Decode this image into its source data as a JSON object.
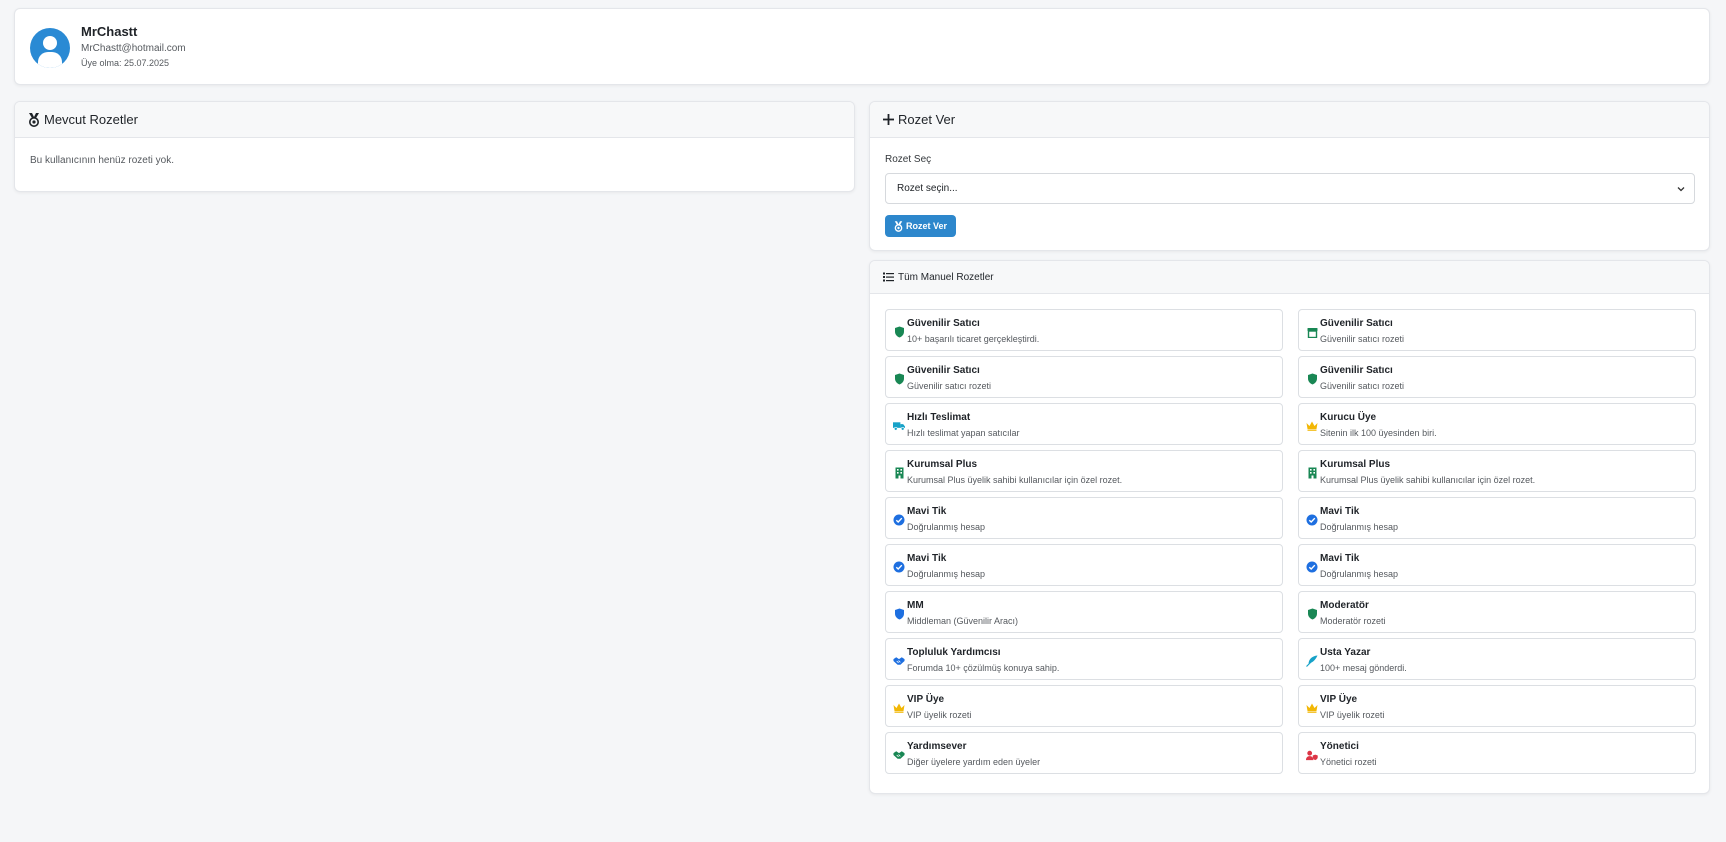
{
  "profile": {
    "username": "MrChastt",
    "email": "MrChastt@hotmail.com",
    "member_since": "Üye olma: 25.07.2025"
  },
  "current_badges": {
    "title": "Mevcut Rozetler",
    "empty_text": "Bu kullanıcının henüz rozeti yok."
  },
  "give_badge": {
    "title": "Rozet Ver",
    "field_label": "Rozet Seç",
    "select_value": "Rozet seçin...",
    "button_label": "Rozet Ver"
  },
  "all_badges": {
    "title": "Tüm Manuel Rozetler",
    "items": [
      {
        "name": "Güvenilir Satıcı",
        "desc": "10+ başarılı ticaret gerçekleştirdi.",
        "icon": "shield-icon",
        "color": "#198754"
      },
      {
        "name": "Güvenilir Satıcı",
        "desc": "Güvenilir satıcı rozeti",
        "icon": "store-icon",
        "color": "#198754"
      },
      {
        "name": "Güvenilir Satıcı",
        "desc": "Güvenilir satıcı rozeti",
        "icon": "shield-icon",
        "color": "#198754"
      },
      {
        "name": "Güvenilir Satıcı",
        "desc": "Güvenilir satıcı rozeti",
        "icon": "shield-icon",
        "color": "#198754"
      },
      {
        "name": "Hızlı Teslimat",
        "desc": "Hızlı teslimat yapan satıcılar",
        "icon": "truck-icon",
        "color": "#17a2c8"
      },
      {
        "name": "Kurucu Üye",
        "desc": "Sitenin ilk 100 üyesinden biri.",
        "icon": "crown-icon",
        "color": "#f2b705"
      },
      {
        "name": "Kurumsal Plus",
        "desc": "Kurumsal Plus üyelik sahibi kullanıcılar için özel rozet.",
        "icon": "building-icon",
        "color": "#198754"
      },
      {
        "name": "Kurumsal Plus",
        "desc": "Kurumsal Plus üyelik sahibi kullanıcılar için özel rozet.",
        "icon": "building-icon",
        "color": "#198754"
      },
      {
        "name": "Mavi Tik",
        "desc": "Doğrulanmış hesap",
        "icon": "check-circle-icon",
        "color": "#1e6fe0"
      },
      {
        "name": "Mavi Tik",
        "desc": "Doğrulanmış hesap",
        "icon": "check-circle-icon",
        "color": "#1e6fe0"
      },
      {
        "name": "Mavi Tik",
        "desc": "Doğrulanmış hesap",
        "icon": "check-circle-icon",
        "color": "#1e6fe0"
      },
      {
        "name": "Mavi Tik",
        "desc": "Doğrulanmış hesap",
        "icon": "check-circle-icon",
        "color": "#1e6fe0"
      },
      {
        "name": "MM",
        "desc": "Middleman (Güvenilir Aracı)",
        "icon": "shield-icon",
        "color": "#1e6fe0"
      },
      {
        "name": "Moderatör",
        "desc": "Moderatör rozeti",
        "icon": "shield-icon",
        "color": "#198754"
      },
      {
        "name": "Topluluk Yardımcısı",
        "desc": "Forumda 10+ çözülmüş konuya sahip.",
        "icon": "handshake-icon",
        "color": "#1e6fe0"
      },
      {
        "name": "Usta Yazar",
        "desc": "100+ mesaj gönderdi.",
        "icon": "feather-icon",
        "color": "#17a2c8"
      },
      {
        "name": "VIP Üye",
        "desc": "VIP üyelik rozeti",
        "icon": "crown-icon",
        "color": "#f2b705"
      },
      {
        "name": "VIP Üye",
        "desc": "VIP üyelik rozeti",
        "icon": "crown-icon",
        "color": "#f2b705"
      },
      {
        "name": "Yardımsever",
        "desc": "Diğer üyelere yardım eden üyeler",
        "icon": "handshake-icon",
        "color": "#198754"
      },
      {
        "name": "Yönetici",
        "desc": "Yönetici rozeti",
        "icon": "user-shield-icon",
        "color": "#dc3545"
      }
    ]
  }
}
